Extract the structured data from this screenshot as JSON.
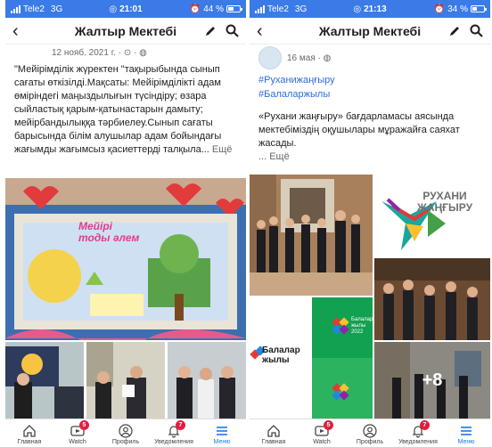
{
  "left": {
    "status": {
      "carrier": "Tele2",
      "network": "3G",
      "time": "21:01",
      "battery": "44 %",
      "battery_level": 0.44
    },
    "header": {
      "title": "Жалтыр Мектебі"
    },
    "post": {
      "meta": "12 нояб. 2021 г. · ",
      "text": "\"Мейірімділік жүректен \"тақырыбында сынып сағаты өткізілді.Мақсаты: Мейірімділікті адам өміріндегі маңыздылығын түсіндіру; өзара сыйластық қарым-қатынастарын дамыту; мейірбандылыққа тәрбиелеу.Сынып сағаты барысында білім алушылар адам бойындағы жағымды жағымсыз қасиеттерді талқыла...",
      "more": "Ещё",
      "poster_text": "Мейірі\nтоды әлем"
    },
    "nav": [
      {
        "label": "Главная",
        "icon": "home-icon",
        "badge": ""
      },
      {
        "label": "Watch",
        "icon": "watch-icon",
        "badge": "5"
      },
      {
        "label": "Профиль",
        "icon": "profile-icon",
        "badge": ""
      },
      {
        "label": "Уведомления",
        "icon": "bell-icon",
        "badge": "7"
      },
      {
        "label": "Меню",
        "icon": "menu-icon",
        "badge": ""
      }
    ]
  },
  "right": {
    "status": {
      "carrier": "Tele2",
      "network": "3G",
      "time": "21:13",
      "battery": "34 %",
      "battery_level": 0.34
    },
    "header": {
      "title": "Жалтыр Мектебі"
    },
    "post": {
      "meta": "16 мая · ",
      "hashtags": [
        "#Руханижаңғыру",
        "#Балаларжылы"
      ],
      "text": "«Рухани жаңғыру» бағдарламасы аясында мектебіміздің оқушылары мұражайға саяхат жасады.",
      "more": "... Ещё",
      "logo_text": "РУХАНИ\nЖАҢҒЫРУ",
      "balalar_text": "Балалар\nжылы\n2022",
      "balalar_small": "Балалар\nжылы",
      "plus_count": "+8"
    },
    "nav": [
      {
        "label": "Главная",
        "icon": "home-icon",
        "badge": ""
      },
      {
        "label": "Watch",
        "icon": "watch-icon",
        "badge": "5"
      },
      {
        "label": "Профиль",
        "icon": "profile-icon",
        "badge": ""
      },
      {
        "label": "Уведомления",
        "icon": "bell-icon",
        "badge": "7"
      },
      {
        "label": "Меню",
        "icon": "menu-icon",
        "badge": ""
      }
    ]
  },
  "colors": {
    "status_bar": "#3b7be8",
    "link": "#2d6cdf",
    "active": "#1877f2",
    "badge": "#e41e3f"
  }
}
